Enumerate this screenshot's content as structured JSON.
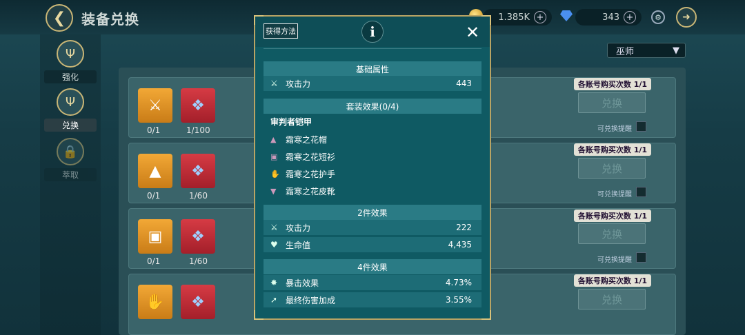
{
  "header": {
    "title": "装备兑换",
    "back_icon": "back-arrow-icon"
  },
  "currency": {
    "gold": "1.385K",
    "gems": "343"
  },
  "sidebar": {
    "items": [
      {
        "label": "强化",
        "icon": "trident-icon"
      },
      {
        "label": "兑换",
        "icon": "trident-icon",
        "active": true
      },
      {
        "label": "萃取",
        "icon": "lock-icon"
      }
    ]
  },
  "class_selector": {
    "value": "巫师"
  },
  "exchange_rows": [
    {
      "item_count": "0/1",
      "mat_count": "1/100",
      "limit": "各账号购买次数 1/1",
      "button": "兑换",
      "remind": "可兑换提醒",
      "item_icon": "staff-icon"
    },
    {
      "item_count": "0/1",
      "mat_count": "1/60",
      "limit": "各账号购买次数 1/1",
      "button": "兑换",
      "remind": "可兑换提醒",
      "item_icon": "wizard-hat-icon"
    },
    {
      "item_count": "0/1",
      "mat_count": "1/60",
      "limit": "各账号购买次数 1/1",
      "button": "兑换",
      "remind": "可兑换提醒",
      "item_icon": "robe-icon"
    },
    {
      "item_count": "",
      "mat_count": "",
      "limit": "各账号购买次数 1/1",
      "button": "兑换",
      "remind": "",
      "item_icon": "gauntlet-icon"
    }
  ],
  "modal": {
    "source_button": "获得方法",
    "base_section": {
      "title": "基础属性",
      "stats": [
        {
          "label": "攻击力",
          "value": "443",
          "icon": "crossed-swords-icon"
        }
      ]
    },
    "set_section": {
      "title": "套装效果(0/4)",
      "set_name": "审判者铠甲",
      "pieces": [
        "霜寒之花帽",
        "霜寒之花短衫",
        "霜寒之花护手",
        "霜寒之花皮靴"
      ]
    },
    "two_piece": {
      "title": "2件效果",
      "stats": [
        {
          "label": "攻击力",
          "value": "222",
          "icon": "crossed-swords-icon"
        },
        {
          "label": "生命值",
          "value": "4,435",
          "icon": "heart-icon"
        }
      ]
    },
    "four_piece": {
      "title": "4件效果",
      "stats": [
        {
          "label": "暴击效果",
          "value": "4.73%",
          "icon": "crit-icon"
        },
        {
          "label": "最终伤害加成",
          "value": "3.55%",
          "icon": "damage-up-icon"
        }
      ]
    }
  },
  "colors": {
    "accent_gold": "#b9a464",
    "modal_bg": "#0f5a63",
    "section_head": "#2a7b85"
  }
}
